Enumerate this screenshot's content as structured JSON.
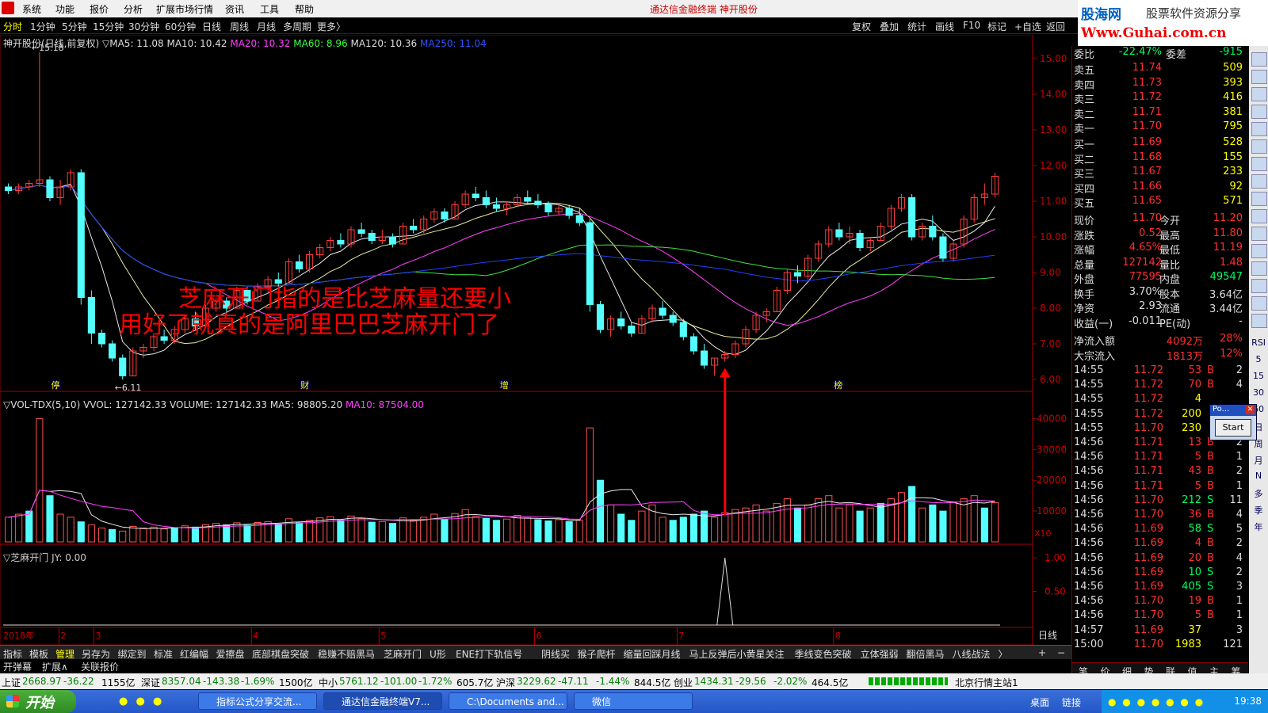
{
  "menu": {
    "items": [
      "系统",
      "功能",
      "报价",
      "分析",
      "扩展市场行情",
      "资讯",
      "工具",
      "帮助"
    ],
    "title": "通达信金融终端  神开股份"
  },
  "logo": {
    "line1": "股海网",
    "line1b": "股票软件资源分享",
    "line2": "Www.Guhai.com.cn"
  },
  "toolbar": {
    "left": [
      "分时",
      "1分钟",
      "5分钟",
      "15分钟",
      "30分钟",
      "60分钟",
      "日线",
      "周线",
      "月线",
      "多周期",
      "更多〉"
    ],
    "right": [
      "复权",
      "叠加",
      "统计",
      "画线",
      "F10",
      "标记",
      "+自选",
      "返回"
    ]
  },
  "legend": {
    "name": "神开股份(日线,前复权)",
    "ma5": "▽MA5: 11.08",
    "ma10": "MA10: 10.42",
    "ma20": "MA20: 10.32",
    "ma60": "MA60: 8.96",
    "ma120": "MA120: 10.36",
    "ma250": "MA250: 11.04"
  },
  "vol_legend": {
    "name": "▽VOL-TDX(5,10)",
    "vvol": "VVOL: 127142.33",
    "volume": "VOLUME: 127142.33",
    "ma5": "MA5: 98805.20",
    "ma10": "MA10: 87504.00"
  },
  "zm_legend": {
    "name": "▽芝麻开门",
    "jy": "JY: 0.00"
  },
  "annotation": {
    "line1": "芝麻开门指的是比芝麻量还要小",
    "line2": "用好了就真的是阿里巴巴芝麻开门了"
  },
  "chart_labels": {
    "high": "←15.18",
    "low": "←6.11",
    "x10": "X10",
    "period": "日线",
    "year": "2018年"
  },
  "event_marks": [
    {
      "x": 0.053,
      "label": "停"
    },
    {
      "x": 0.303,
      "label": "财"
    },
    {
      "x": 0.503,
      "label": "增"
    },
    {
      "x": 0.838,
      "label": "榜"
    }
  ],
  "months": [
    {
      "x": 0.056,
      "label": "2"
    },
    {
      "x": 0.091,
      "label": "3"
    },
    {
      "x": 0.249,
      "label": "4"
    },
    {
      "x": 0.377,
      "label": "5"
    },
    {
      "x": 0.533,
      "label": "6"
    },
    {
      "x": 0.676,
      "label": "7"
    },
    {
      "x": 0.833,
      "label": "8"
    }
  ],
  "price_axis": [
    "15.00",
    "14.00",
    "13.00",
    "12.00",
    "11.00",
    "10.00",
    "9.00",
    "8.00",
    "7.00",
    "6.00"
  ],
  "vol_axis": [
    "40000",
    "30000",
    "20000",
    "10000"
  ],
  "zm_axis": [
    "1.00",
    "0.50"
  ],
  "chart_data": {
    "type": "candlestick",
    "ylim": [
      6,
      15.4
    ],
    "candles": [
      [
        11.4,
        11.5,
        11.2,
        11.3
      ],
      [
        11.3,
        11.5,
        11.2,
        11.4
      ],
      [
        11.4,
        11.6,
        11.3,
        11.5
      ],
      [
        11.5,
        15.18,
        11.4,
        11.6
      ],
      [
        11.6,
        11.7,
        11.0,
        11.1
      ],
      [
        11.1,
        11.6,
        10.9,
        11.4
      ],
      [
        11.4,
        11.9,
        11.3,
        11.8
      ],
      [
        11.8,
        11.9,
        8.1,
        8.3
      ],
      [
        8.3,
        8.5,
        7.0,
        7.3
      ],
      [
        7.3,
        7.4,
        6.9,
        7.0
      ],
      [
        7.0,
        7.1,
        6.5,
        6.6
      ],
      [
        6.6,
        6.7,
        6.0,
        6.1
      ],
      [
        6.1,
        6.9,
        6.1,
        6.8
      ],
      [
        6.8,
        7.0,
        6.6,
        6.9
      ],
      [
        6.9,
        7.3,
        6.8,
        7.2
      ],
      [
        7.2,
        7.4,
        7.0,
        7.1
      ],
      [
        7.1,
        7.5,
        7.0,
        7.4
      ],
      [
        7.4,
        7.8,
        7.3,
        7.7
      ],
      [
        7.7,
        7.9,
        7.4,
        7.5
      ],
      [
        7.5,
        8.1,
        7.5,
        8.0
      ],
      [
        8.0,
        8.3,
        7.9,
        8.2
      ],
      [
        8.2,
        8.3,
        7.9,
        8.0
      ],
      [
        8.0,
        8.6,
        8.0,
        8.5
      ],
      [
        8.5,
        8.6,
        8.1,
        8.2
      ],
      [
        8.2,
        8.7,
        8.2,
        8.6
      ],
      [
        8.6,
        8.9,
        8.4,
        8.8
      ],
      [
        8.8,
        9.0,
        8.6,
        8.7
      ],
      [
        8.7,
        9.4,
        8.7,
        9.3
      ],
      [
        9.3,
        9.5,
        9.0,
        9.1
      ],
      [
        9.1,
        9.6,
        9.0,
        9.5
      ],
      [
        9.5,
        9.8,
        9.4,
        9.7
      ],
      [
        9.7,
        10.0,
        9.6,
        9.9
      ],
      [
        9.9,
        10.1,
        9.7,
        9.8
      ],
      [
        9.8,
        10.3,
        9.7,
        10.2
      ],
      [
        10.2,
        10.4,
        10.0,
        10.1
      ],
      [
        10.1,
        10.2,
        9.8,
        9.9
      ],
      [
        9.9,
        10.2,
        9.8,
        10.0
      ],
      [
        10.0,
        10.1,
        9.7,
        9.8
      ],
      [
        9.8,
        10.4,
        9.8,
        10.3
      ],
      [
        10.3,
        10.5,
        10.1,
        10.2
      ],
      [
        10.2,
        10.6,
        10.1,
        10.5
      ],
      [
        10.5,
        10.8,
        10.4,
        10.7
      ],
      [
        10.7,
        10.8,
        10.4,
        10.5
      ],
      [
        10.5,
        11.0,
        10.5,
        10.9
      ],
      [
        10.9,
        11.3,
        10.8,
        11.2
      ],
      [
        11.2,
        11.4,
        11.0,
        11.1
      ],
      [
        11.1,
        11.3,
        10.8,
        10.9
      ],
      [
        10.9,
        11.1,
        10.7,
        10.8
      ],
      [
        10.8,
        11.0,
        10.6,
        10.9
      ],
      [
        10.9,
        11.2,
        10.9,
        11.1
      ],
      [
        11.1,
        11.3,
        10.9,
        11.0
      ],
      [
        11.0,
        11.2,
        10.8,
        10.9
      ],
      [
        10.9,
        11.0,
        10.6,
        10.7
      ],
      [
        10.7,
        10.9,
        10.6,
        10.8
      ],
      [
        10.8,
        10.9,
        10.5,
        10.6
      ],
      [
        10.6,
        10.8,
        10.3,
        10.4
      ],
      [
        10.4,
        10.5,
        7.9,
        8.1
      ],
      [
        8.1,
        8.2,
        7.3,
        7.4
      ],
      [
        7.4,
        7.8,
        7.2,
        7.7
      ],
      [
        7.7,
        7.9,
        7.4,
        7.5
      ],
      [
        7.5,
        7.6,
        7.2,
        7.3
      ],
      [
        7.3,
        7.8,
        7.3,
        7.7
      ],
      [
        7.7,
        8.1,
        7.6,
        8.0
      ],
      [
        8.0,
        8.2,
        7.7,
        7.8
      ],
      [
        7.8,
        7.9,
        7.5,
        7.6
      ],
      [
        7.6,
        7.7,
        7.1,
        7.2
      ],
      [
        7.2,
        7.3,
        6.7,
        6.8
      ],
      [
        6.8,
        7.0,
        6.3,
        6.4
      ],
      [
        6.4,
        6.6,
        6.11,
        6.6
      ],
      [
        6.6,
        6.8,
        6.5,
        6.7
      ],
      [
        6.7,
        7.1,
        6.6,
        7.0
      ],
      [
        7.0,
        7.5,
        6.9,
        7.4
      ],
      [
        7.4,
        7.9,
        7.3,
        7.8
      ],
      [
        7.8,
        8.0,
        7.6,
        7.9
      ],
      [
        7.9,
        8.6,
        7.9,
        8.5
      ],
      [
        8.5,
        9.1,
        8.4,
        9.0
      ],
      [
        9.0,
        9.2,
        8.7,
        8.9
      ],
      [
        8.9,
        9.5,
        8.8,
        9.4
      ],
      [
        9.4,
        9.9,
        9.3,
        9.8
      ],
      [
        9.8,
        10.3,
        9.7,
        10.2
      ],
      [
        10.2,
        10.4,
        9.9,
        10.0
      ],
      [
        10.0,
        10.3,
        9.8,
        10.1
      ],
      [
        10.1,
        10.2,
        9.6,
        9.7
      ],
      [
        9.7,
        10.0,
        9.6,
        9.9
      ],
      [
        9.9,
        10.4,
        9.9,
        10.3
      ],
      [
        10.3,
        10.9,
        10.2,
        10.8
      ],
      [
        10.8,
        11.2,
        10.7,
        11.1
      ],
      [
        11.1,
        11.2,
        9.9,
        10.0
      ],
      [
        10.0,
        10.4,
        9.9,
        10.3
      ],
      [
        10.3,
        10.6,
        9.9,
        10.0
      ],
      [
        10.0,
        10.1,
        9.3,
        9.4
      ],
      [
        9.4,
        9.9,
        9.3,
        9.8
      ],
      [
        9.8,
        10.6,
        9.7,
        10.5
      ],
      [
        10.5,
        11.2,
        10.4,
        11.1
      ],
      [
        11.1,
        11.5,
        10.9,
        11.2
      ],
      [
        11.2,
        11.8,
        11.1,
        11.7
      ]
    ],
    "volume": [
      8000,
      9000,
      10000,
      40000,
      15000,
      9000,
      8000,
      6500,
      5500,
      4500,
      4000,
      3500,
      5000,
      4500,
      4800,
      4200,
      4600,
      5200,
      4800,
      5600,
      6000,
      5500,
      6200,
      5400,
      6300,
      6600,
      5800,
      7500,
      6200,
      7000,
      7800,
      8200,
      7000,
      8400,
      7600,
      6400,
      6600,
      6000,
      7800,
      7000,
      8000,
      9000,
      7400,
      9200,
      10500,
      8200,
      7600,
      7000,
      7400,
      8600,
      7800,
      7200,
      6800,
      7200,
      6600,
      7000,
      37000,
      20000,
      12000,
      9000,
      7000,
      10000,
      12000,
      8000,
      7000,
      8000,
      9000,
      10000,
      8000,
      9500,
      10500,
      11000,
      12000,
      10000,
      12500,
      14000,
      11000,
      12000,
      14000,
      15000,
      11000,
      12000,
      10000,
      11000,
      12500,
      14000,
      16000,
      18000,
      11000,
      12000,
      10000,
      13000,
      14000,
      15000,
      11000,
      12714
    ],
    "vol_colors_cyan_idx": [
      2,
      4,
      7,
      10,
      16,
      18,
      21,
      23,
      26,
      28,
      32,
      35,
      37,
      42,
      46,
      47,
      51,
      52,
      54,
      57,
      59,
      60,
      64,
      65,
      66,
      67,
      76,
      82,
      84,
      87,
      89,
      90,
      94
    ],
    "zm_signal": {
      "index": 69,
      "value": 1.0
    }
  },
  "quote": {
    "wb_label": "委比",
    "wb_value": "-22.47%",
    "wc_label": "委差",
    "wc_value": "-915",
    "asks": [
      {
        "label": "卖五",
        "price": "11.74",
        "vol": "509"
      },
      {
        "label": "卖四",
        "price": "11.73",
        "vol": "393"
      },
      {
        "label": "卖三",
        "price": "11.72",
        "vol": "416"
      },
      {
        "label": "卖二",
        "price": "11.71",
        "vol": "381"
      },
      {
        "label": "卖一",
        "price": "11.70",
        "vol": "795"
      }
    ],
    "bids": [
      {
        "label": "买一",
        "price": "11.69",
        "vol": "528"
      },
      {
        "label": "买二",
        "price": "11.68",
        "vol": "155"
      },
      {
        "label": "买三",
        "price": "11.67",
        "vol": "233"
      },
      {
        "label": "买四",
        "price": "11.66",
        "vol": "92"
      },
      {
        "label": "买五",
        "price": "11.65",
        "vol": "571"
      }
    ],
    "stats": [
      {
        "l1": "现价",
        "v1": "11.70",
        "l2": "今开",
        "v2": "11.20"
      },
      {
        "l1": "涨跌",
        "v1": "0.52",
        "l2": "最高",
        "v2": "11.80"
      },
      {
        "l1": "涨幅",
        "v1": "4.65%",
        "l2": "最低",
        "v2": "11.19"
      },
      {
        "l1": "总量",
        "v1": "127142",
        "l2": "量比",
        "v2": "1.48"
      },
      {
        "l1": "外盘",
        "v1": "77595",
        "l2": "内盘",
        "v2": "49547"
      },
      {
        "l1": "换手",
        "v1": "3.70%",
        "l2": "股本",
        "v2": "3.64亿"
      },
      {
        "l1": "净资",
        "v1": "2.93",
        "l2": "流通",
        "v2": "3.44亿"
      },
      {
        "l1": "收益(一)",
        "v1": "-0.011",
        "l2": "PE(动)",
        "v2": "-"
      }
    ],
    "flow": [
      {
        "l": "净流入额",
        "v": "4092万",
        "p": "28%"
      },
      {
        "l": "大宗流入",
        "v": "1813万",
        "p": "12%"
      }
    ],
    "ticks": [
      {
        "t": "14:55",
        "p": "11.72",
        "v": "53",
        "d": "B",
        "n": "2"
      },
      {
        "t": "14:55",
        "p": "11.72",
        "v": "70",
        "d": "B",
        "n": "4"
      },
      {
        "t": "14:55",
        "p": "11.72",
        "v": "4",
        "d": "",
        "n": ""
      },
      {
        "t": "14:55",
        "p": "11.72",
        "v": "200",
        "d": "",
        "n": ""
      },
      {
        "t": "14:55",
        "p": "11.70",
        "v": "230",
        "d": "",
        "n": ""
      },
      {
        "t": "14:56",
        "p": "11.71",
        "v": "13",
        "d": "B",
        "n": "2"
      },
      {
        "t": "14:56",
        "p": "11.71",
        "v": "5",
        "d": "B",
        "n": "1"
      },
      {
        "t": "14:56",
        "p": "11.71",
        "v": "43",
        "d": "B",
        "n": "2"
      },
      {
        "t": "14:56",
        "p": "11.71",
        "v": "5",
        "d": "B",
        "n": "1"
      },
      {
        "t": "14:56",
        "p": "11.70",
        "v": "212",
        "d": "S",
        "n": "11"
      },
      {
        "t": "14:56",
        "p": "11.70",
        "v": "36",
        "d": "B",
        "n": "4"
      },
      {
        "t": "14:56",
        "p": "11.69",
        "v": "58",
        "d": "S",
        "n": "5"
      },
      {
        "t": "14:56",
        "p": "11.69",
        "v": "4",
        "d": "B",
        "n": "2"
      },
      {
        "t": "14:56",
        "p": "11.69",
        "v": "20",
        "d": "B",
        "n": "4"
      },
      {
        "t": "14:56",
        "p": "11.69",
        "v": "10",
        "d": "S",
        "n": "2"
      },
      {
        "t": "14:56",
        "p": "11.69",
        "v": "405",
        "d": "S",
        "n": "3"
      },
      {
        "t": "14:56",
        "p": "11.70",
        "v": "19",
        "d": "B",
        "n": "1"
      },
      {
        "t": "14:56",
        "p": "11.70",
        "v": "5",
        "d": "B",
        "n": "1"
      },
      {
        "t": "14:57",
        "p": "11.69",
        "v": "37",
        "d": "",
        "n": "3"
      },
      {
        "t": "15:00",
        "p": "11.70",
        "v": "1983",
        "d": "",
        "n": "121"
      }
    ],
    "bottom_tabs": [
      "笔",
      "价",
      "细",
      "势",
      "联",
      "值",
      "主",
      "筹"
    ]
  },
  "iconbar": [
    "RSI",
    "5",
    "15",
    "30",
    "60",
    "日",
    "周",
    "月",
    "N",
    "多",
    "季",
    "年"
  ],
  "popup": {
    "title": "Po...",
    "button": "Start"
  },
  "indicator_tabs": [
    "指标",
    "模板",
    "管理",
    "另存为",
    "绑定到",
    "标准",
    "红编幅",
    "爱擦盘",
    "底部棋盘突破",
    "稳赚不赔黑马",
    "芝麻开门",
    "U形",
    "ENE打下轨信号",
    "阴线买",
    "猴子爬杆",
    "缩量回踩月线",
    "马上反弹后小黄星关注",
    "季线变色突破",
    "立体强弱",
    "翻倍黑马",
    "八线战法",
    "〉"
  ],
  "tabs2": [
    "开弹幕",
    "扩展∧",
    "关联报价"
  ],
  "status": [
    {
      "label": "上证",
      "v": "2668.97",
      "c": "-36.22",
      "p": "1155亿"
    },
    {
      "label": "深证",
      "v": "8357.04",
      "c": "-143.38",
      "pc": "-1.69%",
      "p": "1500亿"
    },
    {
      "label": "中小",
      "v": "5761.12",
      "c": "-101.00",
      "pc": "-1.72%",
      "p": "605.7亿"
    },
    {
      "label": "沪深",
      "v": "3229.62",
      "c": "-47.11",
      "pc": "-1.44%",
      "p": "844.5亿"
    },
    {
      "label": "创业",
      "v": "1434.31",
      "c": "-29.56",
      "pc": "-2.02%",
      "p": "464.5亿"
    }
  ],
  "status_station": "北京行情主站1",
  "taskbar": {
    "start": "开始",
    "tasks": [
      "指标公式分享交流...",
      "通达信金融终端V7...",
      "C:\\Documents and...",
      "微信"
    ],
    "tray_links": [
      "桌面",
      "链接"
    ],
    "time": "19:38"
  }
}
